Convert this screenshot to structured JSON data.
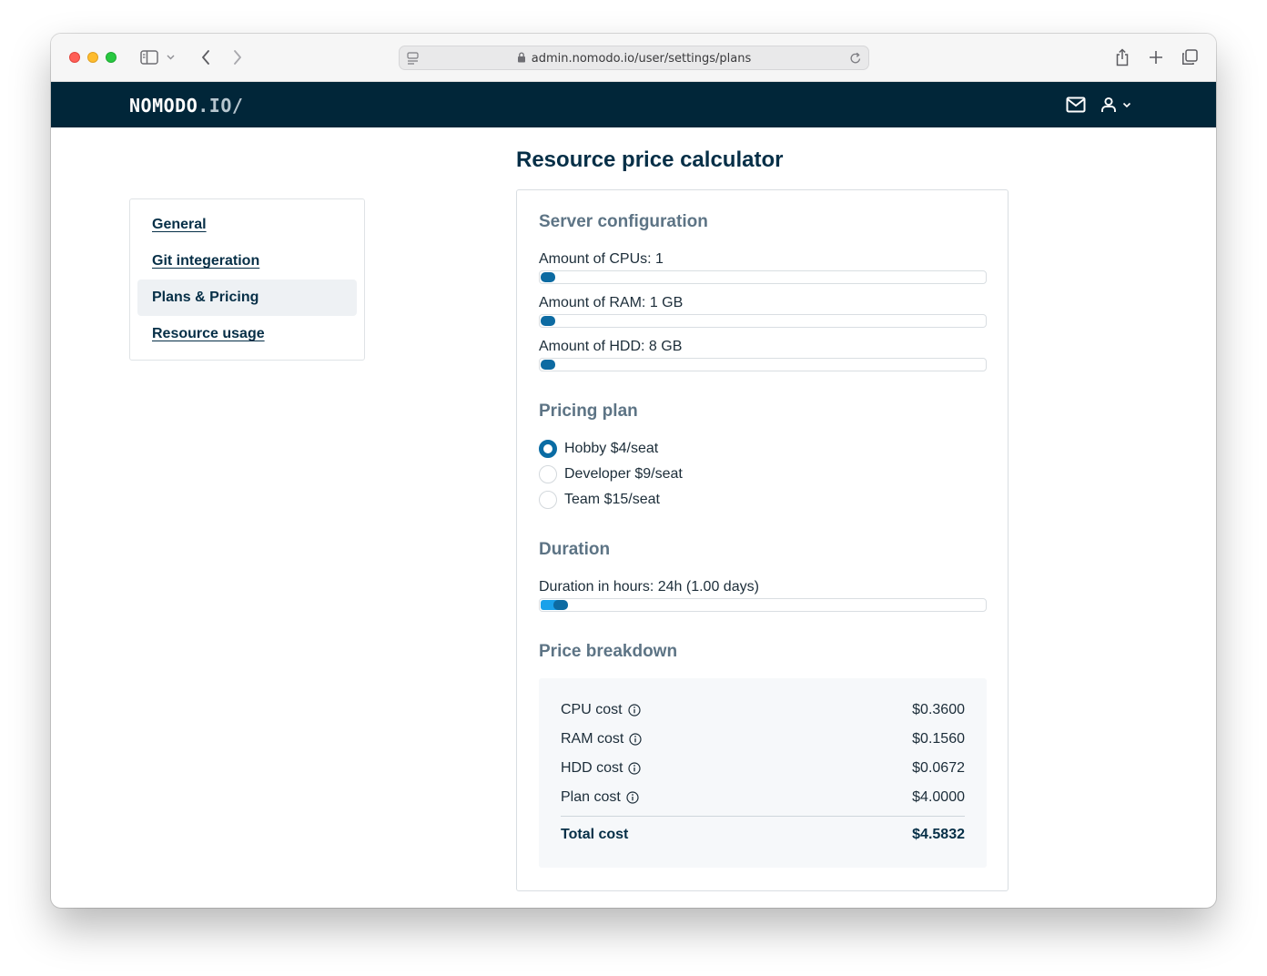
{
  "browser": {
    "url": "admin.nomodo.io/user/settings/plans"
  },
  "header": {
    "logo_main": "NOMODO",
    "logo_suffix": ".IO/"
  },
  "sidebar": {
    "items": [
      {
        "label": "General",
        "active": false
      },
      {
        "label": "Git integeration",
        "active": false
      },
      {
        "label": "Plans & Pricing",
        "active": true
      },
      {
        "label": "Resource usage",
        "active": false
      }
    ]
  },
  "main": {
    "title": "Resource price calculator",
    "server_config": {
      "heading": "Server configuration",
      "cpu_label": "Amount of CPUs: 1",
      "ram_label": "Amount of RAM: 1 GB",
      "hdd_label": "Amount of HDD: 8 GB"
    },
    "pricing_plan": {
      "heading": "Pricing plan",
      "options": [
        {
          "label": "Hobby $4/seat",
          "selected": true
        },
        {
          "label": "Developer $9/seat",
          "selected": false
        },
        {
          "label": "Team $15/seat",
          "selected": false
        }
      ]
    },
    "duration": {
      "heading": "Duration",
      "label": "Duration in hours: 24h (1.00 days)"
    },
    "breakdown": {
      "heading": "Price breakdown",
      "rows": [
        {
          "label": "CPU cost",
          "value": "$0.3600"
        },
        {
          "label": "RAM cost",
          "value": "$0.1560"
        },
        {
          "label": "HDD cost",
          "value": "$0.0672"
        },
        {
          "label": "Plan cost",
          "value": "$4.0000"
        }
      ],
      "total_label": "Total cost",
      "total_value": "$4.5832"
    }
  },
  "colors": {
    "header_bg": "#012639",
    "accent": "#0a6ca4",
    "slider_fill": "#1aa1ea"
  }
}
